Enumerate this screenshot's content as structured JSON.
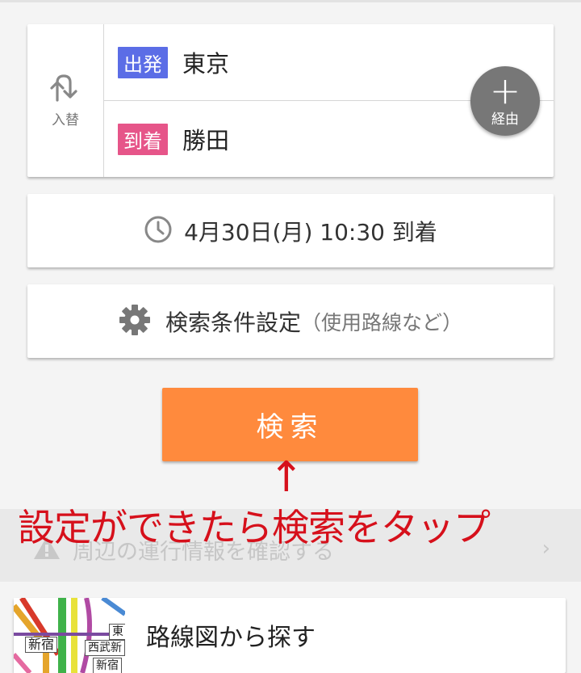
{
  "route": {
    "swap_label": "入替",
    "from_tag": "出発",
    "from_station": "東京",
    "to_tag": "到着",
    "to_station": "勝田",
    "via_label": "経由"
  },
  "datetime": {
    "label": "4月30日(月) 10:30 到着"
  },
  "conditions": {
    "label": "検索条件設定",
    "sublabel": "（使用路線など）"
  },
  "search_button": {
    "label": "検索"
  },
  "annotation": {
    "arrow": "↑",
    "text": "設定ができたら検索をタップ"
  },
  "info": {
    "label": "周辺の運行情報を確認する"
  },
  "route_map": {
    "label": "路線図から探す",
    "thumb_labels": [
      "新宿",
      "東",
      "西武新",
      "新宿"
    ]
  },
  "colors": {
    "search": "#ff8a3d",
    "from_tag": "#5b6de6",
    "to_tag": "#e65589",
    "annotation": "#d6101b"
  }
}
